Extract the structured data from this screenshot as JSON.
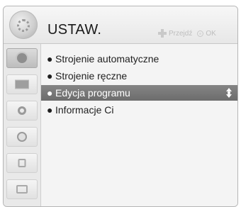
{
  "header": {
    "title": "USTAW.",
    "hint_move": "Przejdź",
    "hint_ok": "OK"
  },
  "sidebar": {
    "items": [
      {
        "icon": "antenna-icon",
        "active": true
      },
      {
        "icon": "picture-icon",
        "active": false
      },
      {
        "icon": "audio-icon",
        "active": false
      },
      {
        "icon": "time-icon",
        "active": false
      },
      {
        "icon": "lock-icon",
        "active": false
      },
      {
        "icon": "option-icon",
        "active": false
      }
    ]
  },
  "menu": {
    "bullet": "●",
    "items": [
      {
        "label": "Strojenie automatyczne",
        "selected": false
      },
      {
        "label": "Strojenie ręczne",
        "selected": false
      },
      {
        "label": "Edycja programu",
        "selected": true
      },
      {
        "label": "Informacje Ci",
        "selected": false
      }
    ]
  },
  "colors": {
    "selected_bg": "#7a7a7a",
    "panel_bg": "#f3f3f3",
    "hint_text": "#bdbdbd"
  }
}
